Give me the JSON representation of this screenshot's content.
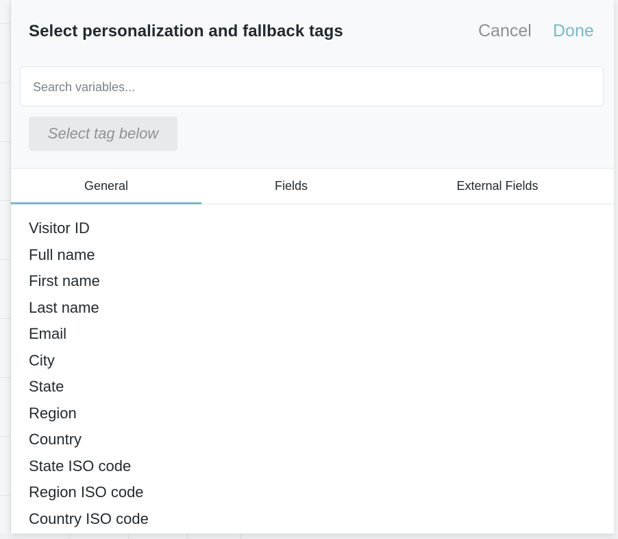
{
  "modal": {
    "title": "Select personalization and fallback tags",
    "cancel_label": "Cancel",
    "done_label": "Done"
  },
  "search": {
    "placeholder": "Search variables...",
    "value": ""
  },
  "selected_tag": {
    "label": "Select tag below"
  },
  "tabs": [
    {
      "label": "General",
      "active": true
    },
    {
      "label": "Fields",
      "active": false
    },
    {
      "label": "External Fields",
      "active": false
    }
  ],
  "variables": [
    "Visitor ID",
    "Full name",
    "First name",
    "Last name",
    "Email",
    "City",
    "State",
    "Region",
    "Country",
    "State ISO code",
    "Region ISO code",
    "Country ISO code"
  ],
  "colors": {
    "accent": "#79b6c6",
    "title_text": "#222a30",
    "muted_text": "#8c9095",
    "header_bg": "#f8f9fa"
  }
}
